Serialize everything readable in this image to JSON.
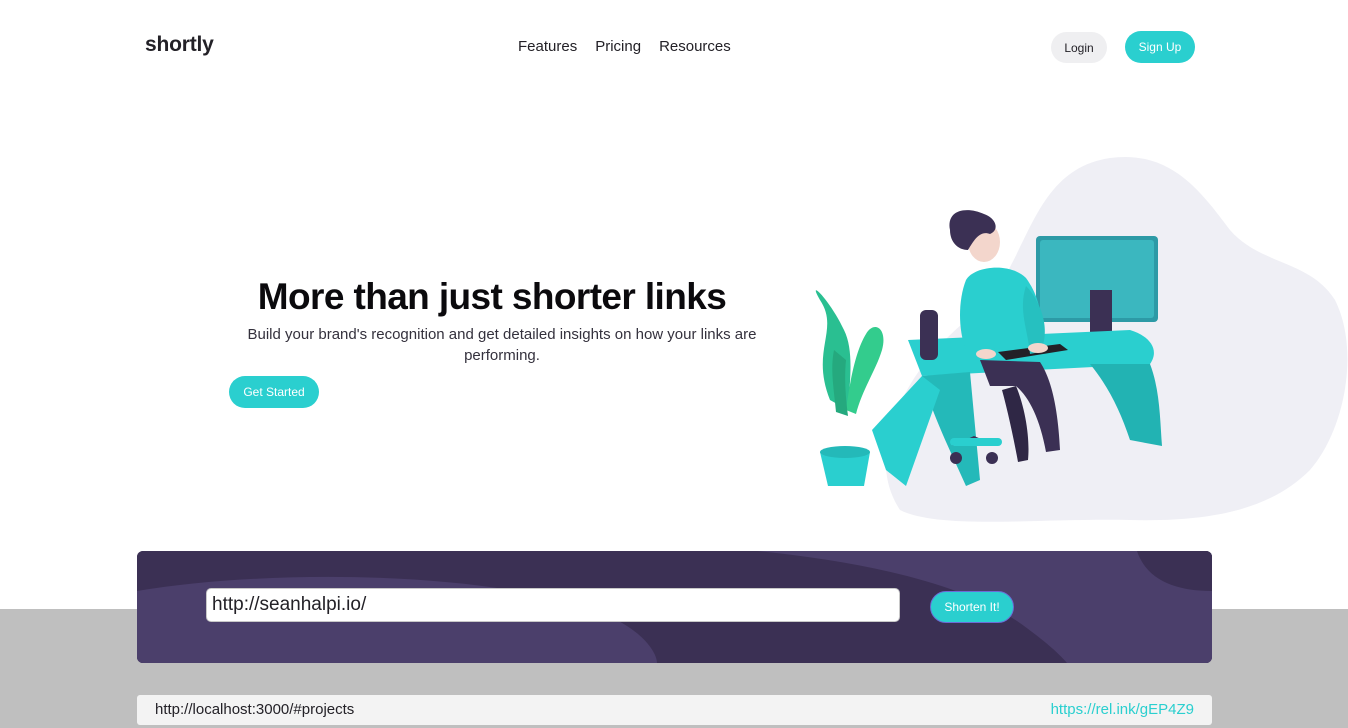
{
  "header": {
    "logo": "shortly",
    "nav": [
      "Features",
      "Pricing",
      "Resources"
    ],
    "login_label": "Login",
    "signup_label": "Sign Up"
  },
  "hero": {
    "title": "More than just shorter links",
    "subtitle": "Build your brand's recognition and get detailed insights on how your links are performing.",
    "cta_label": "Get Started"
  },
  "shorten": {
    "input_value": "http://seanhalpi.io/",
    "button_label": "Shorten It!"
  },
  "results": [
    {
      "original": "http://localhost:3000/#projects",
      "short": "https://rel.ink/gEP4Z9"
    }
  ],
  "colors": {
    "accent": "#2acfcf",
    "dark_violet": "#3b3054",
    "violet_light": "#4b3f6b",
    "text": "#232127",
    "band_gray": "#bfbfbf"
  },
  "icons": {
    "illustration": "person-working-at-desk-illustration"
  }
}
